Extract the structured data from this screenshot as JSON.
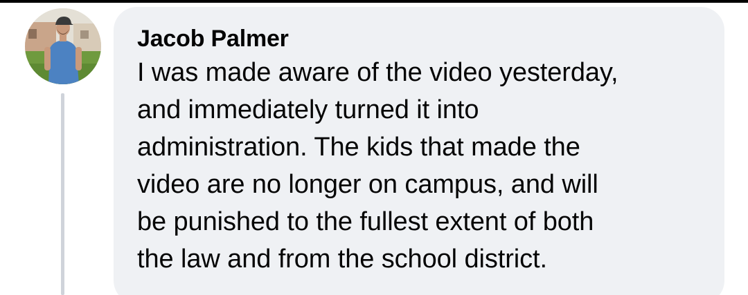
{
  "comment": {
    "author": "Jacob Palmer",
    "avatar_icon": "profile-photo-avatar",
    "lines": [
      "I was made aware of the video yesterday,",
      "and immediately turned it into",
      "administration. The kids that made the",
      "video are no longer on campus, and will",
      "be punished to the fullest extent of both",
      "the law and from the school district."
    ]
  },
  "colors": {
    "bubble_background": "#eff1f4",
    "text": "#050505",
    "thread_line": "#cfd3da"
  }
}
